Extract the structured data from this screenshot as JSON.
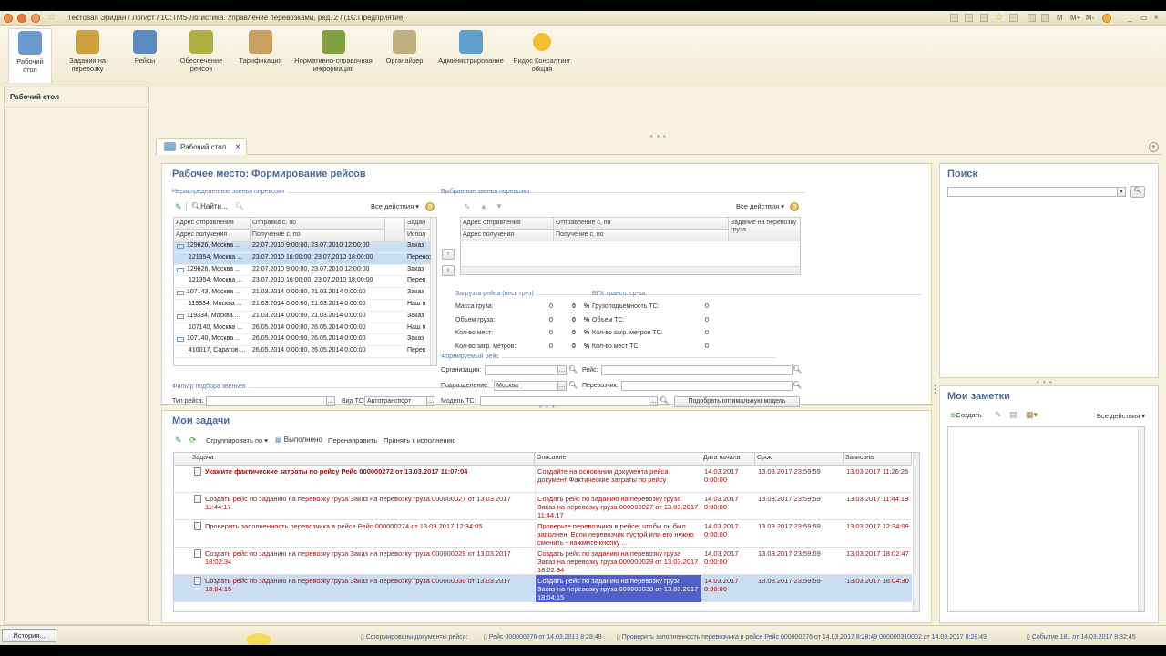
{
  "app": {
    "title": "Тестовая Эридан / Логист / 1С:TMS Логистика. Управление перевозками, ред. 2 / (1С:Предприятие)",
    "toolbar_right": [
      "M",
      "M+",
      "M-"
    ]
  },
  "sections": [
    {
      "label": "Рабочий\nстол",
      "icon": "desk-icon",
      "color": "#6a9ad0"
    },
    {
      "label": "Задания на\nперевозку",
      "icon": "truck-icon",
      "color": "#d0a040"
    },
    {
      "label": "Рейсы",
      "icon": "trip-icon",
      "color": "#5a8ac0"
    },
    {
      "label": "Обеспечение\nрейсов",
      "icon": "coins-icon",
      "color": "#b0b040"
    },
    {
      "label": "Тарификация",
      "icon": "tariff-icon",
      "color": "#c8a060"
    },
    {
      "label": "Нормативно-справочная\nинформация",
      "icon": "books-icon",
      "color": "#80a040"
    },
    {
      "label": "Органайзер",
      "icon": "clipboard-icon",
      "color": "#c0b080"
    },
    {
      "label": "Администрирование",
      "icon": "admin-icon",
      "color": "#60a0d0"
    },
    {
      "label": "Ридос Консалтинг\nобщая",
      "icon": "circle-icon",
      "color": "#f0c030"
    }
  ],
  "left_panel": {
    "items": [
      "Рабочий стол"
    ]
  },
  "tab": {
    "label": "Рабочий стол",
    "close": "×"
  },
  "workplace": {
    "title": "Рабочее место: Формирование рейсов",
    "unassigned_group": "Нераспределенные звенья перевозки",
    "selected_group": "Выбранные звенья перевозки",
    "find_label": "Найти...",
    "all_actions": "Все действия",
    "unassigned_headers": [
      "Адрес отправления",
      "Отправка с, по",
      "Задан",
      "Адрес получения",
      "Получение с, по",
      "Испол"
    ],
    "unassigned_rows": [
      {
        "addr": "129626, Москва ...",
        "period": "22.07.2010 9:00:00, 23.07.2010 12:00:00",
        "task": "Заказ"
      },
      {
        "addr": "121354, Москва ...",
        "period": "23.07.2010 16:00:00, 23.07.2010 18:00:00",
        "task": "Перевоз"
      },
      {
        "addr": "129626, Москва ...",
        "period": "22.07.2010 9:00:00, 23.07.2010 12:00:00",
        "task": "Заказ"
      },
      {
        "addr": "121354, Москва ...",
        "period": "23.07.2010 16:00:00, 23.07.2010 18:00:00",
        "task": "Перев"
      },
      {
        "addr": "107143, Москва ...",
        "period": "21.03.2014 0:00:00, 21.03.2014 0:00:00",
        "task": "Заказ"
      },
      {
        "addr": "119334, Москва ...",
        "period": "21.03.2014 0:00:00, 21.03.2014 0:00:00",
        "task": "Наш п"
      },
      {
        "addr": "119334, Москва ...",
        "period": "21.03.2014 0:00:00, 21.03.2014 0:00:00",
        "task": "Заказ"
      },
      {
        "addr": "107140, Москва ...",
        "period": "26.05.2014 0:00:00, 26.05.2014 0:00:00",
        "task": "Наш п"
      },
      {
        "addr": "107140, Москва ...",
        "period": "26.05.2014 0:00:00, 26.05.2014 0:00:00",
        "task": "Заказ"
      },
      {
        "addr": "410017, Саратов ...",
        "period": "26.05.2014 0:00:00, 26.05.2014 0:00:00",
        "task": "Перев"
      }
    ],
    "selected_headers": [
      "Адрес отправления",
      "Отправление с, по",
      "Задание на перевозку груза",
      "Адрес получения",
      "Получение с, по"
    ],
    "load_group": "Загрузка рейса (весь груз)",
    "vgh_group": "ВГХ трансп. ср-ва",
    "load_rows": [
      {
        "label": "Масса груза:",
        "value": "0",
        "pct": "0",
        "tlabel": "Грузоподъемность ТС:",
        "tvalue": "0"
      },
      {
        "label": "Объем груза:",
        "value": "0",
        "pct": "0",
        "tlabel": "Объем ТС:",
        "tvalue": "0"
      },
      {
        "label": "Кол-во мест:",
        "value": "0",
        "pct": "0",
        "tlabel": "Кол-во загр. метров ТС:",
        "tvalue": "0"
      },
      {
        "label": "Кол-во загр. метров:",
        "value": "0",
        "pct": "0",
        "tlabel": "Кол-во мест ТС:",
        "tvalue": "0"
      }
    ],
    "pct_sign": "%",
    "form_group": "Формируемый рейс",
    "org_label": "Организация:",
    "trip_label": "Рейс:",
    "dept_label": "Подразделение:",
    "dept_value": "Москва",
    "carrier_label": "Перевозчик:",
    "model_label": "Модель ТС:",
    "pick_button": "Подобрать оптимальную модель",
    "filter_group": "Фильтр подбора звеньев",
    "trip_type_label": "Тип рейса:",
    "vehicle_type_label": "Вид ТС:",
    "vehicle_type_value": "Автотранспорт"
  },
  "tasks": {
    "title": "Мои задачи",
    "group_by": "Сгруппировать по",
    "done": "Выполнено",
    "redirect": "Перенаправить",
    "accept": "Принять к исполнению",
    "headers": [
      "Задача",
      "Описание",
      "Дата начала",
      "Срок",
      "Записана"
    ],
    "rows": [
      {
        "task": "Укажите фактические затраты по рейсу Рейс 000000272 от 13.03.2017 11:07:04",
        "desc": "Создайте на основании документа рейса документ Фактические затраты по рейсу",
        "start": "14.03.2017 0:00:00",
        "due": "13.03.2017 23:59:59",
        "created": "13.03.2017 11:26:25",
        "bold": true
      },
      {
        "task": "Создать рейс по заданию на перевозку груза Заказ на перевозку груза 000000027 от 13.03.2017 11:44:17",
        "desc": "Создать рейс по заданию на перевозку груза Заказ на перевозку груза 000000027 от 13.03.2017 11:44:17",
        "start": "14.03.2017 0:00:00",
        "due": "13.03.2017 23:59:59",
        "created": "13.03.2017 11:44:19",
        "bold": false
      },
      {
        "task": "Проверить заполненность перевозчика в рейсе Рейс 000000274 от 13.03.2017 12:34:05",
        "desc": "Проверьте перевозчика в рейсе, чтобы он был заполнен. Если перевозчик пустой или его нужно сменить - нажмите кнопку ...",
        "start": "14.03.2017 0:00:00",
        "due": "13.03.2017 23:59:59",
        "created": "13.03.2017 12:34:09",
        "bold": false
      },
      {
        "task": "Создать рейс по заданию на перевозку груза Заказ на перевозку груза 000000029 от 13.03.2017 18:02:34",
        "desc": "Создать рейс по заданию на перевозку груза Заказ на перевозку груза 000000029 от 13.03.2017 18:02:34",
        "start": "14.03.2017 0:00:00",
        "due": "13.03.2017 23:59:59",
        "created": "13.03.2017 18:02:47",
        "bold": false
      },
      {
        "task": "Создать рейс по заданию на перевозку груза Заказ на перевозку груза 000000030 от 13.03.2017 18:04:15",
        "desc": "Создать рейс по заданию на перевозку груза Заказ на перевозку груза 000000030 от 13.03.2017 18:04:15",
        "start": "14.03.2017 0:00:00",
        "due": "13.03.2017 23:59:59",
        "created": "13.03.2017 18:04:30",
        "bold": false
      }
    ]
  },
  "search": {
    "title": "Поиск"
  },
  "notes": {
    "title": "Мои заметки",
    "create": "Создать",
    "all_actions": "Все действия"
  },
  "statusbar": {
    "history": "История...",
    "items": [
      "Сформированы документы рейса:",
      "Рейс 000000276 от 14.03.2017 8:28:49",
      "Проверить заполненность перевозчика в рейсе Рейс 000000276 от 14.03.2017 8:28:49 000000310002 от 14.03.2017 8:28:49",
      "Событие 181 от 14.03.2017 8:32:45"
    ]
  }
}
